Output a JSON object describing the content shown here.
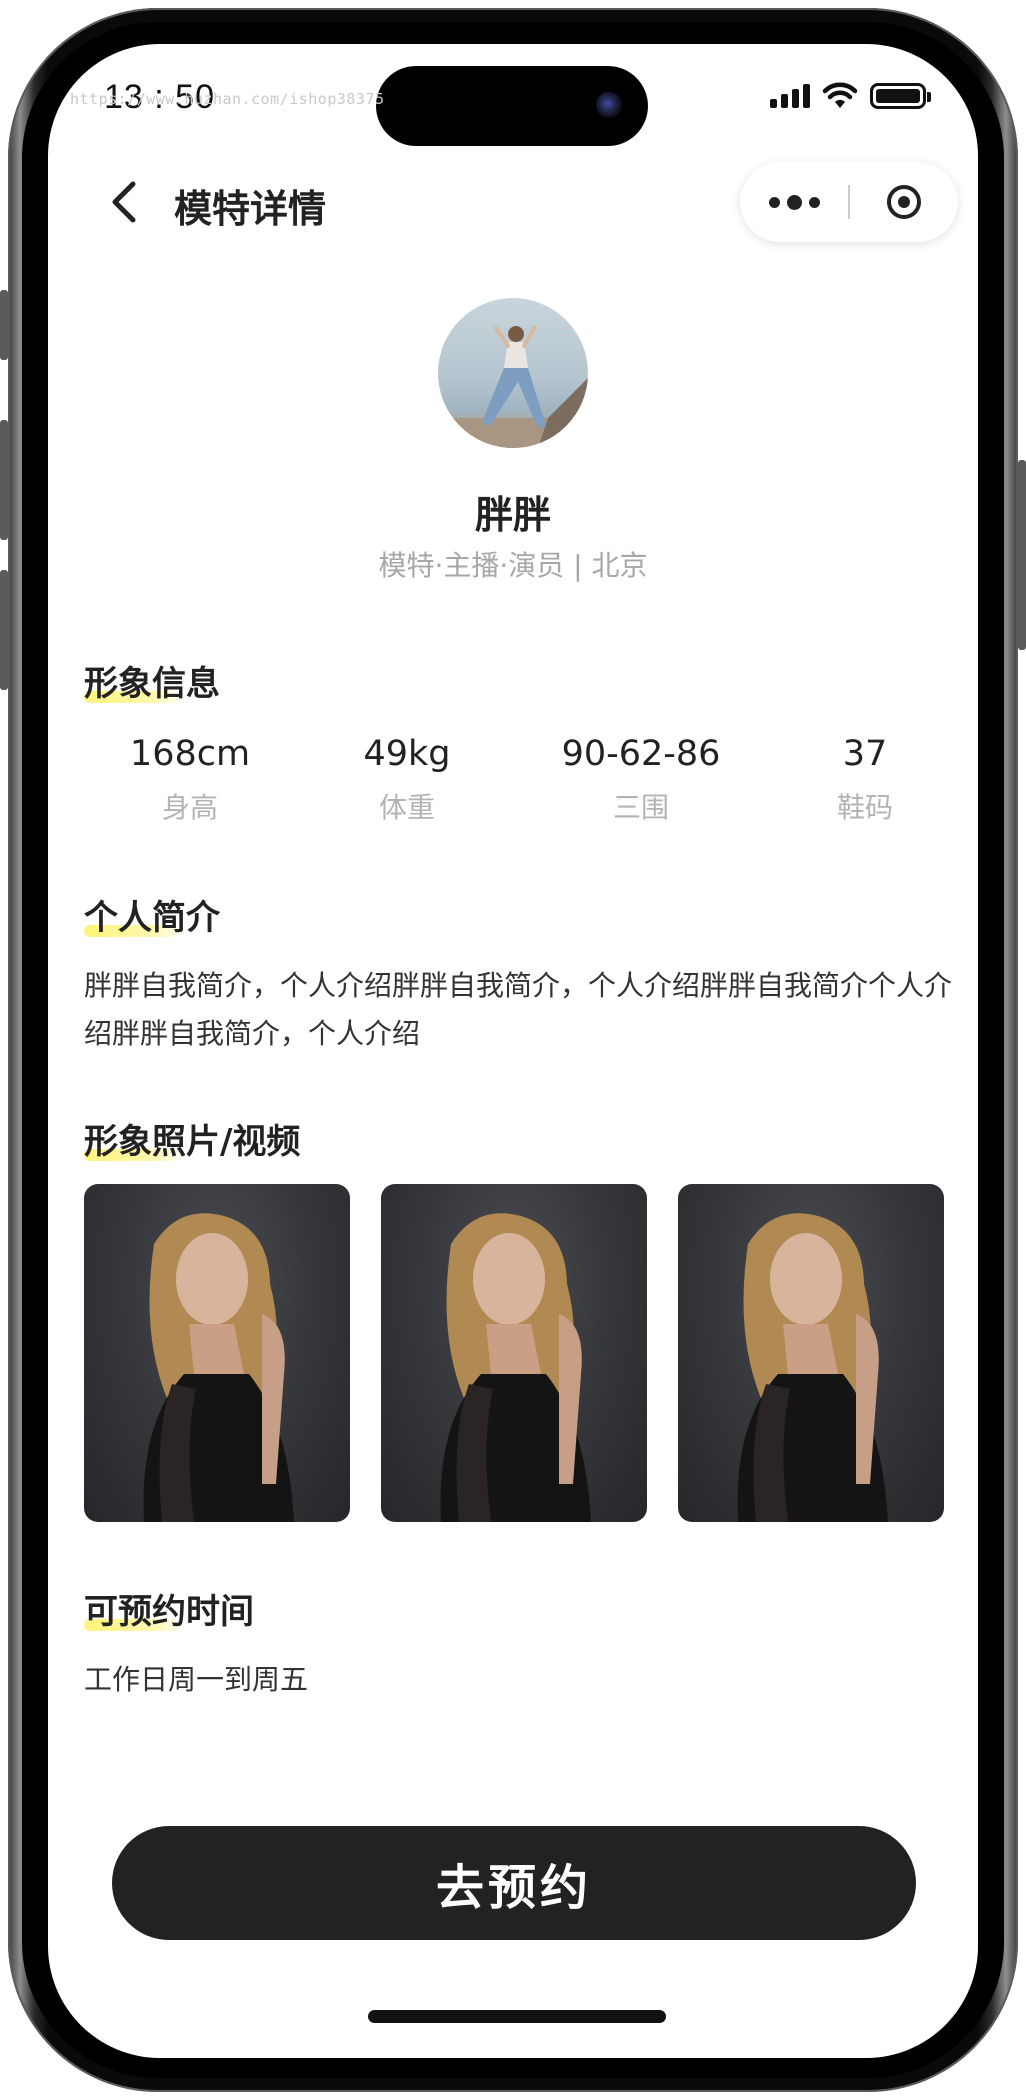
{
  "watermark": "https://www.huzhan.com/ishop38375",
  "status_bar": {
    "time": "13 : 50"
  },
  "nav": {
    "title": "模特详情"
  },
  "profile": {
    "name": "胖胖",
    "tags": "模特·主播·演员 | 北京"
  },
  "sections": {
    "image_info": "形象信息",
    "intro": "个人简介",
    "media": "形象照片/视频",
    "availability": "可预约时间"
  },
  "stats": [
    {
      "value": "168cm",
      "label": "身高"
    },
    {
      "value": "49kg",
      "label": "体重"
    },
    {
      "value": "90-62-86",
      "label": "三围"
    },
    {
      "value": "37",
      "label": "鞋码"
    }
  ],
  "intro_text": "胖胖自我简介，个人介绍胖胖自我简介，个人介绍胖胖自我简介个人介绍胖胖自我简介，个人介绍",
  "photos": [
    {
      "name": "model-photo-1"
    },
    {
      "name": "model-photo-2"
    },
    {
      "name": "model-photo-3"
    }
  ],
  "availability_text": "工作日周一到周五",
  "book_button": "去预约",
  "colors": {
    "button_bg": "#222222",
    "highlight": "#fff47a",
    "muted_text": "#a7a7a7"
  },
  "icons": [
    "back-arrow-icon",
    "more-dots-icon",
    "target-close-icon",
    "signal-icon",
    "wifi-icon",
    "battery-icon"
  ]
}
